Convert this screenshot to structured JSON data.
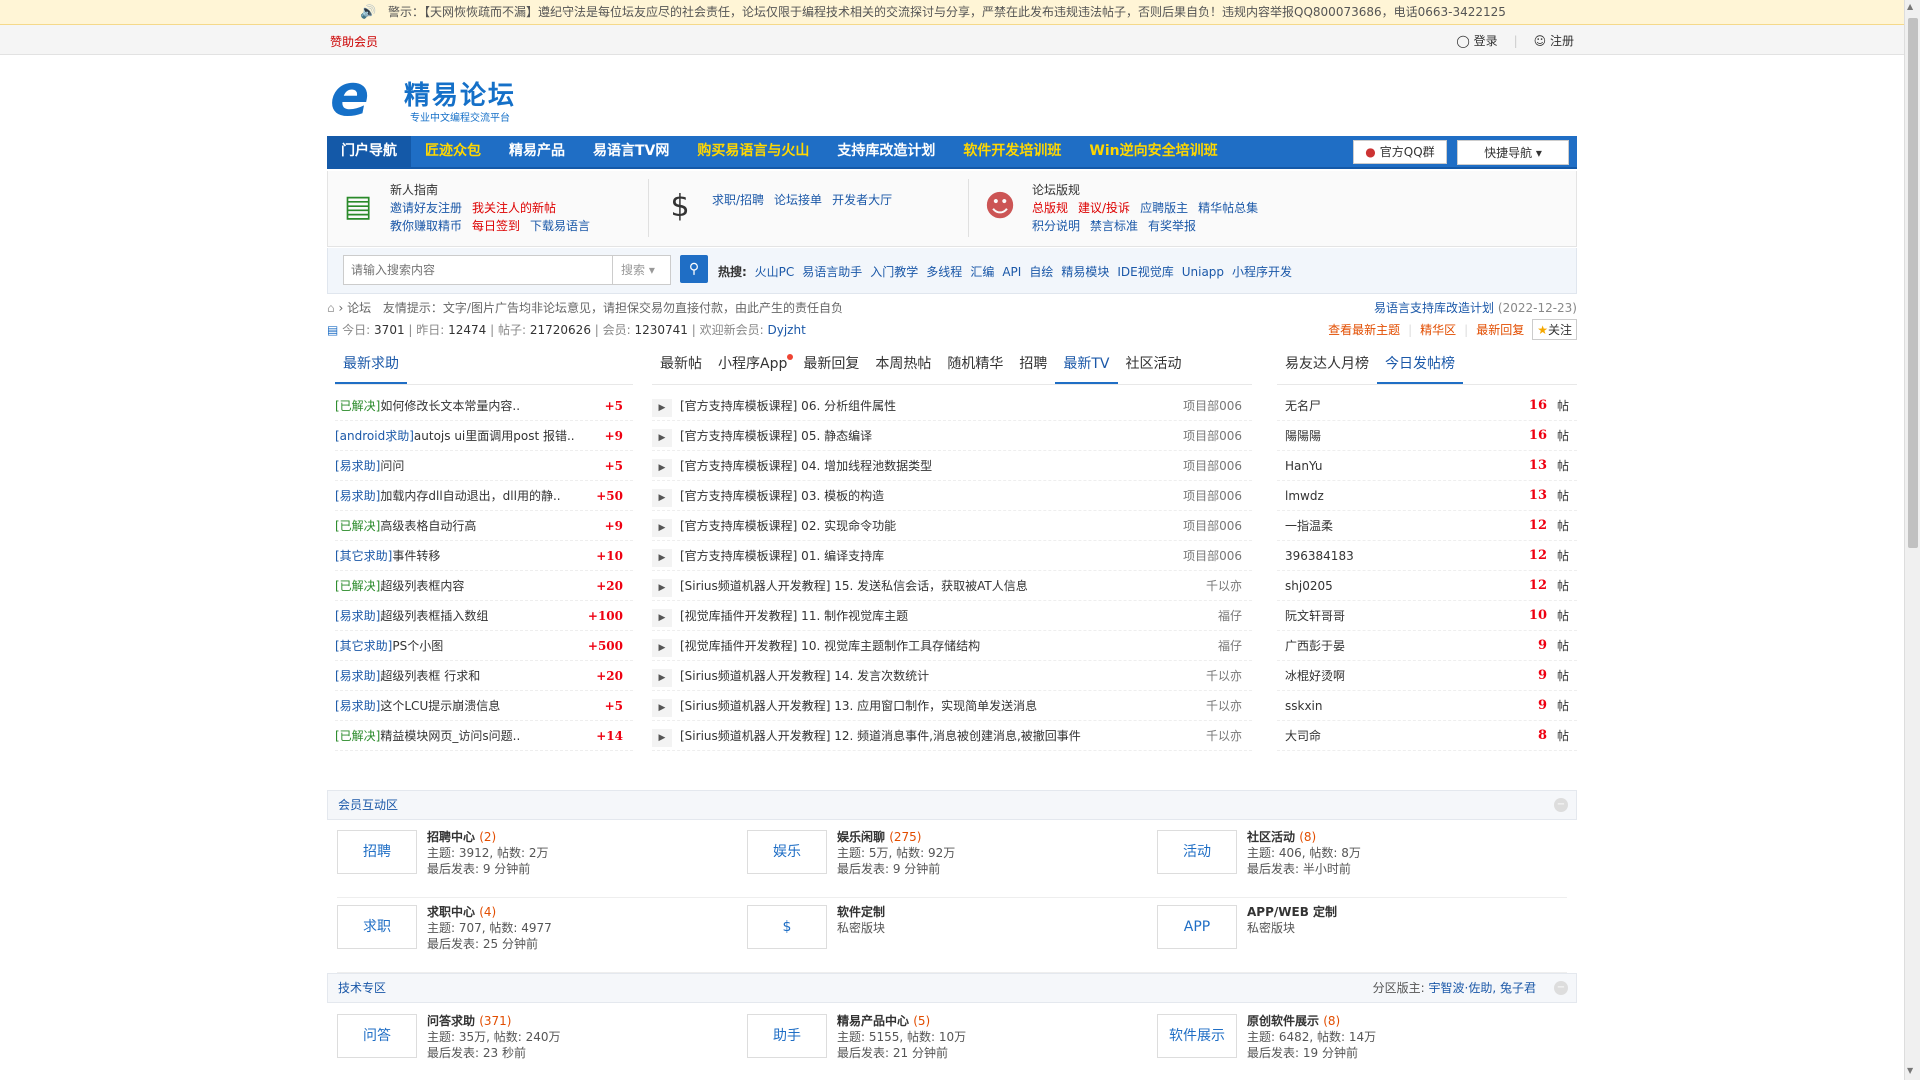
{
  "notice": "警示：【天网恢恢疏而不漏】遵纪守法是每位坛友应尽的社会责任，论坛仅限于编程技术相关的交流探讨与分享，严禁在此发布违规违法帖子，否则后果自负！违规内容举报QQ800073686，电话0663-3422125",
  "topbar": {
    "sponsor": "赞助会员",
    "login": "登录",
    "register": "注册"
  },
  "logo": {
    "name": "精易论坛",
    "slogan": "专业中文编程交流平台"
  },
  "nav": {
    "items": [
      "门户导航",
      "匠迹众包",
      "精易产品",
      "易语言TV网",
      "购买易语言与火山",
      "支持库改造计划",
      "软件开发培训班",
      "Win逆向安全培训班"
    ],
    "qq": "官方QQ群",
    "quick": "快捷导航"
  },
  "guide": {
    "g1": {
      "title": "新人指南",
      "links": [
        "邀请好友注册",
        "我关注人的新帖",
        "教你赚取精币",
        "每日签到",
        "下载易语言"
      ]
    },
    "g2": {
      "links": [
        "求职/招聘",
        "论坛接单",
        "开发者大厅"
      ]
    },
    "g3": {
      "title": "论坛版规",
      "links": [
        "总版规",
        "建议/投诉",
        "应聘版主",
        "精华帖总集",
        "积分说明",
        "禁言标准",
        "有奖举报"
      ]
    }
  },
  "search": {
    "placeholder": "请输入搜索内容",
    "type": "搜索",
    "hot_label": "热搜:",
    "hot": [
      "火山PC",
      "易语言助手",
      "入门教学",
      "多线程",
      "汇编",
      "API",
      "自绘",
      "精易模块",
      "IDE视觉库",
      "Uniapp",
      "小程序开发"
    ]
  },
  "crumb": {
    "forum": "论坛",
    "tip": "友情提示：文字/图片广告均非论坛意见，请担保交易勿直接付款，由此产生的责任自负",
    "right": "易语言支持库改造计划",
    "right_date": "(2022-12-23)"
  },
  "stats": {
    "today_l": "今日:",
    "today": "3701",
    "yest_l": "昨日:",
    "yest": "12474",
    "posts_l": "帖子:",
    "posts": "21720626",
    "members_l": "会员:",
    "members": "1230741",
    "welcome": "欢迎新会员:",
    "newuser": "Dyjzht",
    "latest": "查看最新主题",
    "digest": "精华区",
    "reply": "最新回复",
    "follow": "关注"
  },
  "help": {
    "tab": "最新求助",
    "rows": [
      {
        "tag": "[已解决]",
        "title": "如何修改长文本常量内容..",
        "pts": "+5"
      },
      {
        "tag": "[android求助]",
        "title": "autojs ui里面调用post 报错..",
        "pts": "+9"
      },
      {
        "tag": "[易求助]",
        "title": "问问",
        "pts": "+5"
      },
      {
        "tag": "[易求助]",
        "title": "加载内存dll自动退出，dll用的静..",
        "pts": "+50"
      },
      {
        "tag": "[已解决]",
        "title": "高级表格自动行高",
        "pts": "+9"
      },
      {
        "tag": "[其它求助]",
        "title": "事件转移",
        "pts": "+10"
      },
      {
        "tag": "[已解决]",
        "title": "超级列表框内容",
        "pts": "+20"
      },
      {
        "tag": "[易求助]",
        "title": "超级列表框插入数组",
        "pts": "+100"
      },
      {
        "tag": "[其它求助]",
        "title": "PS个小图",
        "pts": "+500"
      },
      {
        "tag": "[易求助]",
        "title": "超级列表框 行求和",
        "pts": "+20"
      },
      {
        "tag": "[易求助]",
        "title": "这个LCU提示崩溃信息",
        "pts": "+5"
      },
      {
        "tag": "[已解决]",
        "title": "精益模块网页_访问s问题..",
        "pts": "+14"
      }
    ]
  },
  "mid": {
    "tabs": [
      "最新帖",
      "小程序App",
      "最新回复",
      "本周热帖",
      "随机精华",
      "招聘",
      "最新TV",
      "社区活动"
    ],
    "rows": [
      {
        "title": "[官方支持库模板课程] 06. 分析组件属性",
        "author": "项目部006"
      },
      {
        "title": "[官方支持库模板课程] 05. 静态编译",
        "author": "项目部006"
      },
      {
        "title": "[官方支持库模板课程] 04. 增加线程池数据类型",
        "author": "项目部006"
      },
      {
        "title": "[官方支持库模板课程] 03. 模板的构造",
        "author": "项目部006"
      },
      {
        "title": "[官方支持库模板课程] 02. 实现命令功能",
        "author": "项目部006"
      },
      {
        "title": "[官方支持库模板课程] 01. 编译支持库",
        "author": "项目部006"
      },
      {
        "title": "[Sirius频道机器人开发教程] 15. 发送私信会话，获取被AT人信息",
        "author": "千以亦"
      },
      {
        "title": "[视觉库插件开发教程] 11. 制作视觉库主题",
        "author": "福仔"
      },
      {
        "title": "[视觉库插件开发教程] 10. 视觉库主题制作工具存储结构",
        "author": "福仔"
      },
      {
        "title": "[Sirius频道机器人开发教程] 14. 发言次数统计",
        "author": "千以亦"
      },
      {
        "title": "[Sirius频道机器人开发教程] 13. 应用窗口制作，实现简单发送消息",
        "author": "千以亦"
      },
      {
        "title": "[Sirius频道机器人开发教程] 12. 频道消息事件,消息被创建消息,被撤回事件",
        "author": "千以亦"
      }
    ]
  },
  "rank": {
    "tabs": [
      "易友达人月榜",
      "今日发帖榜"
    ],
    "unit": "帖",
    "rows": [
      {
        "name": "无名尸",
        "count": "16"
      },
      {
        "name": "陽陽陽",
        "count": "16"
      },
      {
        "name": "HanYu",
        "count": "13"
      },
      {
        "name": "lmwdz",
        "count": "13"
      },
      {
        "name": "一指温柔",
        "count": "12"
      },
      {
        "name": "396384183",
        "count": "12"
      },
      {
        "name": "shj0205",
        "count": "12"
      },
      {
        "name": "阮文轩哥哥",
        "count": "10"
      },
      {
        "name": "广西彭于晏",
        "count": "9"
      },
      {
        "name": "冰棍好烫啊",
        "count": "9"
      },
      {
        "name": "sskxin",
        "count": "9"
      },
      {
        "name": "大司命",
        "count": "8"
      }
    ]
  },
  "sect1": {
    "title": "会员互动区",
    "forums": [
      {
        "icon": "招聘",
        "name": "招聘中心",
        "cnt": "(2)",
        "l1": "主题: 3912, 帖数: 2万",
        "l2": "最后发表: 9 分钟前"
      },
      {
        "icon": "娱乐",
        "name": "娱乐闲聊",
        "cnt": "(275)",
        "l1": "主题: 5万, 帖数: 92万",
        "l2": "最后发表: 9 分钟前"
      },
      {
        "icon": "活动",
        "name": "社区活动",
        "cnt": "(8)",
        "l1": "主题: 406, 帖数: 8万",
        "l2": "最后发表: 半小时前"
      },
      {
        "icon": "求职",
        "name": "求职中心",
        "cnt": "(4)",
        "l1": "主题: 707, 帖数: 4977",
        "l2": "最后发表: 25 分钟前"
      },
      {
        "icon": "$",
        "name": "软件定制",
        "cnt": "",
        "l1": "私密版块",
        "l2": ""
      },
      {
        "icon": "APP",
        "name": "APP/WEB 定制",
        "cnt": "",
        "l1": "私密版块",
        "l2": ""
      }
    ]
  },
  "sect2": {
    "title": "技术专区",
    "mods_l": "分区版主:",
    "mods": "宇智波·佐助, 兔子君",
    "forums": [
      {
        "icon": "问答",
        "name": "问答求助",
        "cnt": "(371)",
        "l1": "主题: 35万, 帖数: 240万",
        "l2": "最后发表: 23 秒前"
      },
      {
        "icon": "助手",
        "name": "精易产品中心",
        "cnt": "(5)",
        "l1": "主题: 5155, 帖数: 10万",
        "l2": "最后发表: 21 分钟前"
      },
      {
        "icon": "软件展示",
        "name": "原创软件展示",
        "cnt": "(8)",
        "l1": "主题: 6482, 帖数: 14万",
        "l2": "最后发表: 19 分钟前"
      }
    ]
  }
}
